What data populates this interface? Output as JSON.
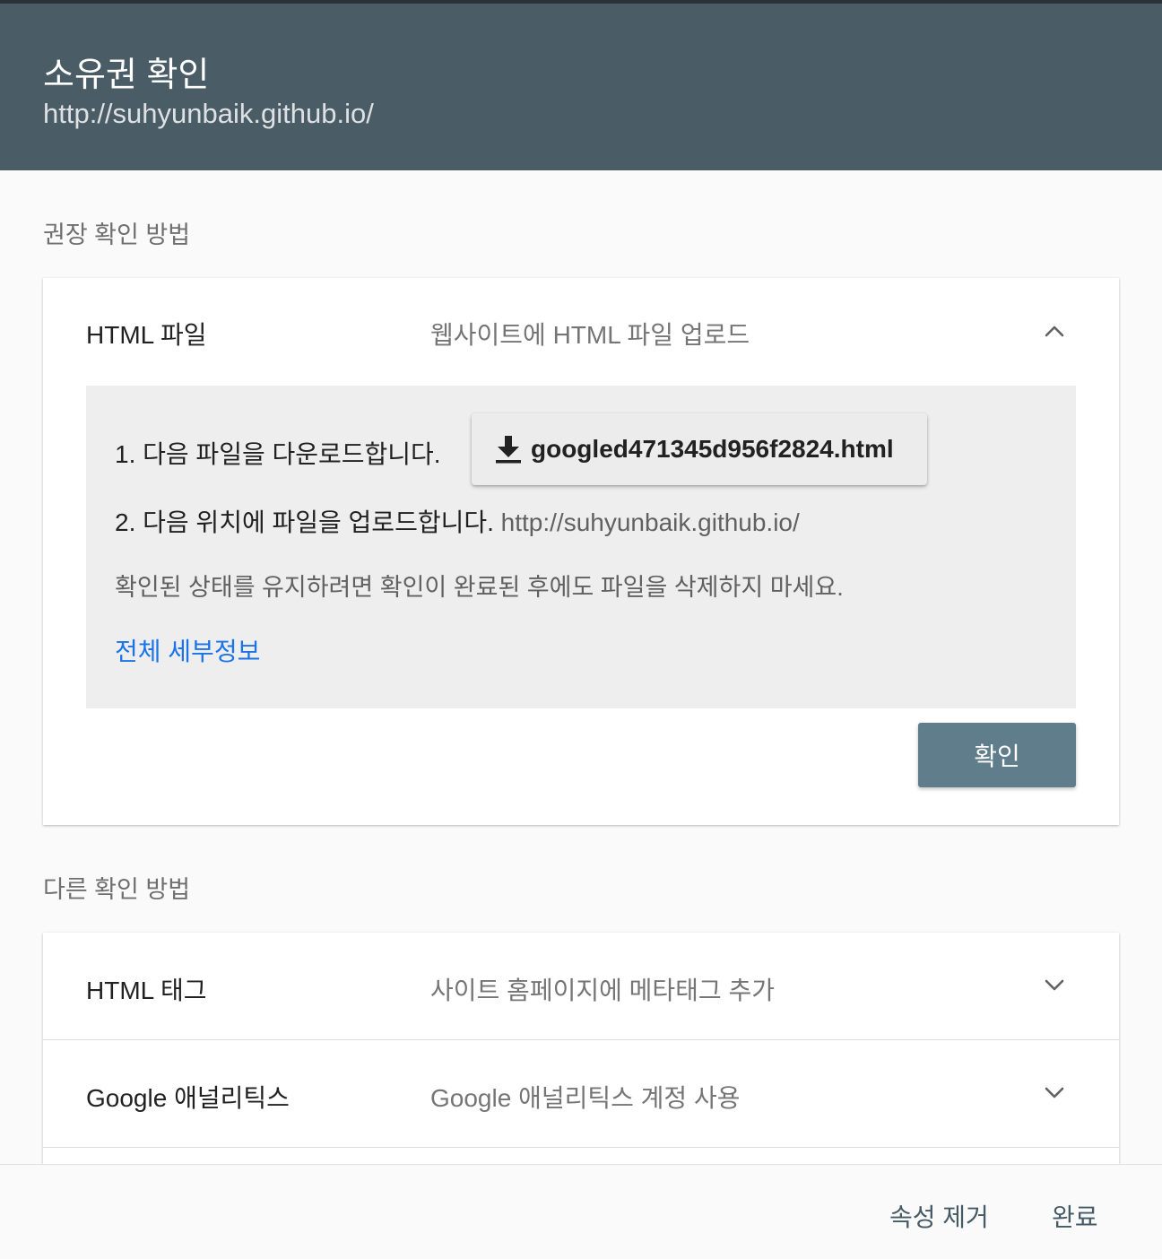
{
  "header": {
    "title": "소유권 확인",
    "subtitle": "http://suhyunbaik.github.io/"
  },
  "recommended": {
    "section_label": "권장 확인 방법",
    "method": {
      "title": "HTML 파일",
      "description": "웹사이트에 HTML 파일 업로드",
      "expand_icon": "chevron-up-icon",
      "step1_text": "1. 다음 파일을 다운로드합니다.",
      "download_icon": "download-icon",
      "download_filename": "googled471345d956f2824.html",
      "step2_text": "2. 다음 위치에 파일을 업로드합니다.",
      "step2_url": "http://suhyunbaik.github.io/",
      "note": "확인된 상태를 유지하려면 확인이 완료된 후에도 파일을 삭제하지 마세요.",
      "details_link": "전체 세부정보",
      "verify_button": "확인"
    }
  },
  "other": {
    "section_label": "다른 확인 방법",
    "methods": [
      {
        "title": "HTML 태그",
        "description": "사이트 홈페이지에 메타태그 추가",
        "icon": "chevron-down-icon"
      },
      {
        "title": "Google 애널리틱스",
        "description": "Google 애널리틱스 계정 사용",
        "icon": "chevron-down-icon"
      }
    ]
  },
  "footer": {
    "remove_property": "속성 제거",
    "done": "완료"
  },
  "colors": {
    "header_bg": "#4a5c66",
    "verify_button_bg": "#607d8b",
    "link": "#1a73e8"
  }
}
